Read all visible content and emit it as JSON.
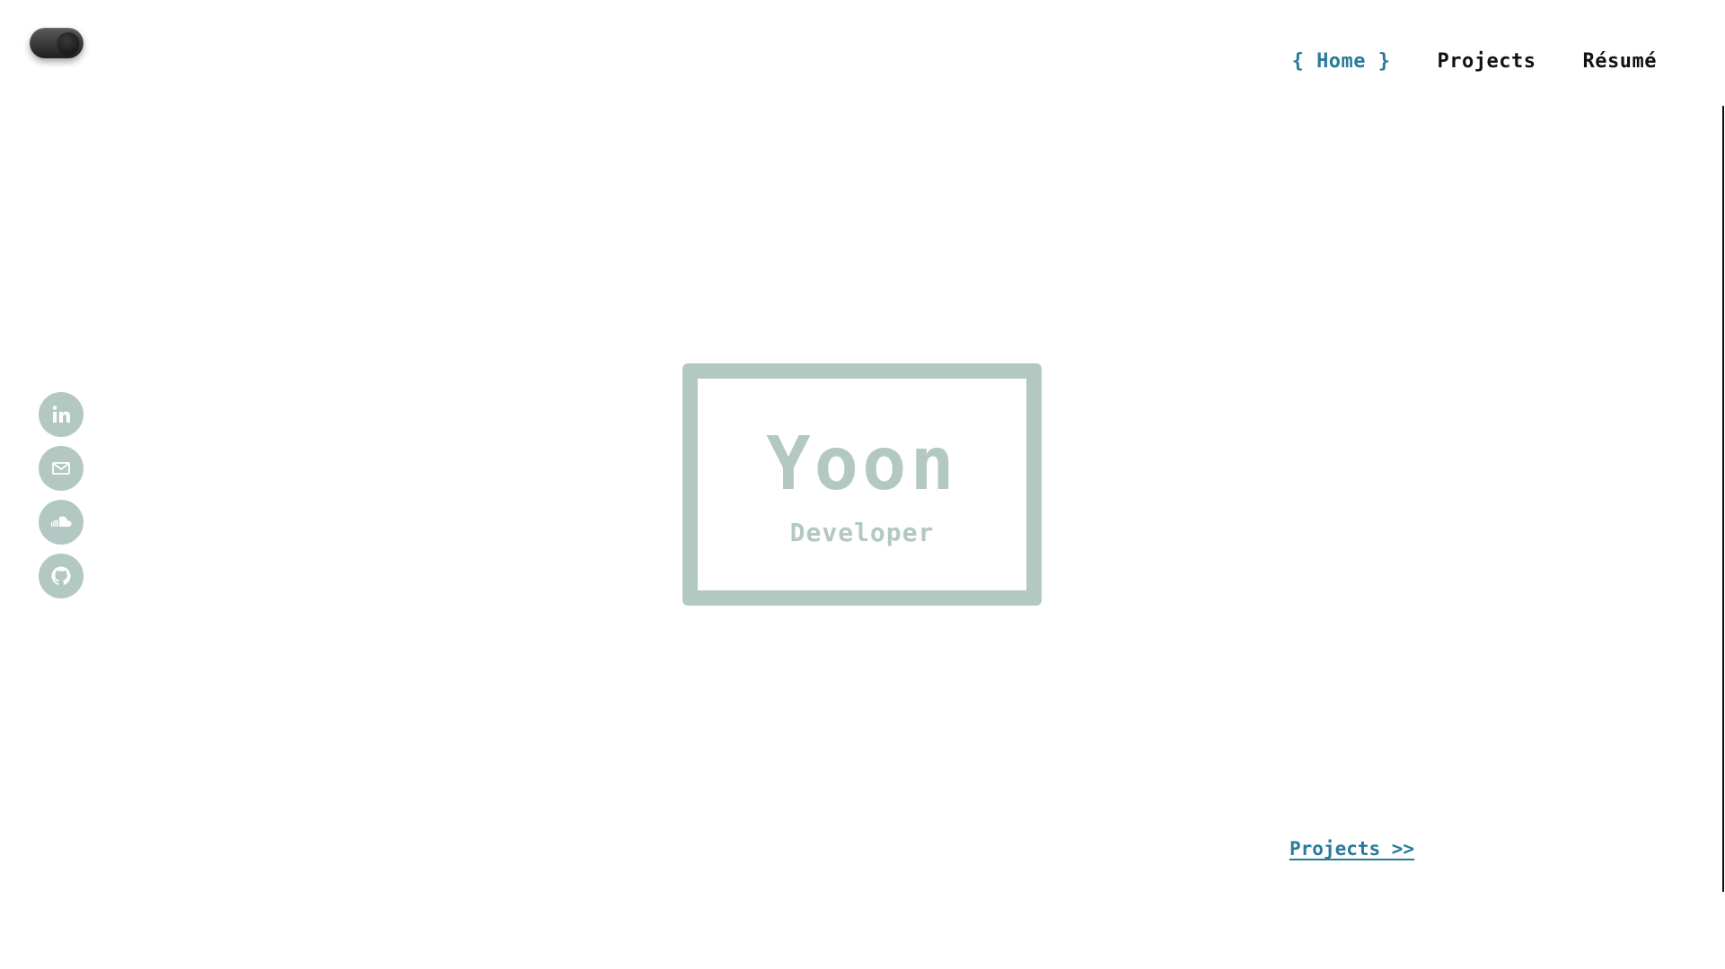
{
  "theme_toggle": {
    "state": "dark-on"
  },
  "nav": {
    "home_open": "{",
    "home_label": "Home",
    "home_close": "}",
    "projects_label": "Projects",
    "resume_label": "Résumé"
  },
  "socials": [
    {
      "name": "linkedin",
      "icon": "linkedin-icon"
    },
    {
      "name": "email",
      "icon": "mail-icon"
    },
    {
      "name": "soundcloud",
      "icon": "soundcloud-icon"
    },
    {
      "name": "github",
      "icon": "github-icon"
    }
  ],
  "hero": {
    "name": "Yoon",
    "role": "Developer"
  },
  "footer_link": {
    "label": "Projects >>"
  },
  "colors": {
    "accent": "#2a7a9b",
    "muted": "#b3c8c2",
    "text": "#111111"
  }
}
